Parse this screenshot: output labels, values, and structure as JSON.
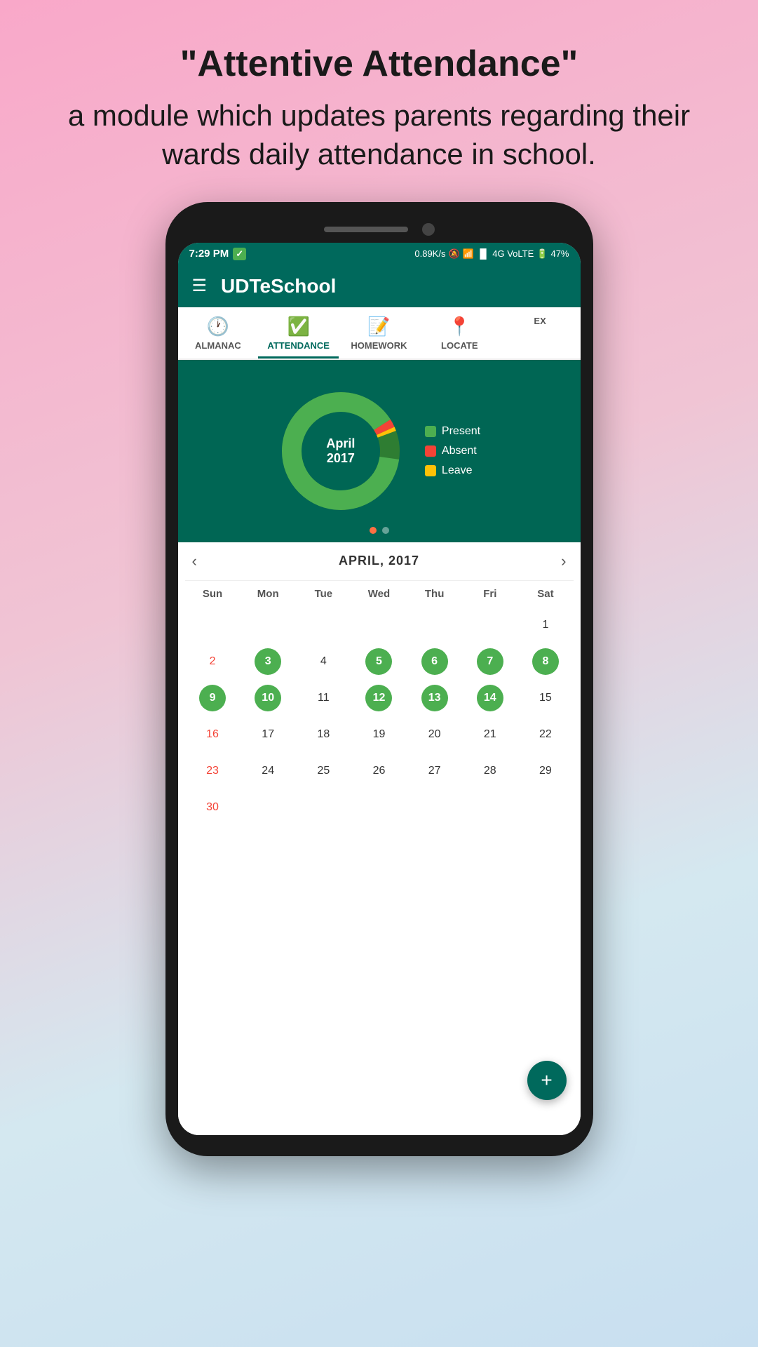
{
  "background": {
    "tagline_line1": "\"Attentive Attendance\"",
    "tagline_line2": "a module which updates parents regarding their wards daily attendance in school."
  },
  "status_bar": {
    "time": "7:29 PM",
    "network_info": "0.89K/s",
    "battery": "47%",
    "signal": "4G VoLTE"
  },
  "header": {
    "title": "UDTeSchool"
  },
  "tabs": [
    {
      "id": "almanac",
      "label": "ALMANAC",
      "active": false
    },
    {
      "id": "attendance",
      "label": "ATTENDANCE",
      "active": true
    },
    {
      "id": "homework",
      "label": "HOMEWORK",
      "active": false
    },
    {
      "id": "locate",
      "label": "LOCATE",
      "active": false
    },
    {
      "id": "ex",
      "label": "EX",
      "active": false
    }
  ],
  "chart": {
    "month": "April",
    "year": "2017",
    "legend": [
      {
        "id": "present",
        "label": "Present",
        "color": "green"
      },
      {
        "id": "absent",
        "label": "Absent",
        "color": "red"
      },
      {
        "id": "leave",
        "label": "Leave",
        "color": "orange"
      }
    ]
  },
  "calendar": {
    "title": "APRIL, 2017",
    "day_headers": [
      "Sun",
      "Mon",
      "Tue",
      "Wed",
      "Thu",
      "Fri",
      "Sat"
    ],
    "weeks": [
      [
        {
          "num": "",
          "type": "empty"
        },
        {
          "num": "",
          "type": "empty"
        },
        {
          "num": "",
          "type": "empty"
        },
        {
          "num": "",
          "type": "empty"
        },
        {
          "num": "",
          "type": "empty"
        },
        {
          "num": "",
          "type": "empty"
        },
        {
          "num": "1",
          "type": "normal"
        }
      ],
      [
        {
          "num": "2",
          "type": "sunday"
        },
        {
          "num": "3",
          "type": "present"
        },
        {
          "num": "4",
          "type": "normal"
        },
        {
          "num": "5",
          "type": "present"
        },
        {
          "num": "6",
          "type": "present"
        },
        {
          "num": "7",
          "type": "present"
        },
        {
          "num": "8",
          "type": "present"
        }
      ],
      [
        {
          "num": "9",
          "type": "present"
        },
        {
          "num": "10",
          "type": "present"
        },
        {
          "num": "11",
          "type": "normal"
        },
        {
          "num": "12",
          "type": "present"
        },
        {
          "num": "13",
          "type": "present"
        },
        {
          "num": "14",
          "type": "present"
        },
        {
          "num": "15",
          "type": "normal"
        }
      ],
      [
        {
          "num": "16",
          "type": "sunday"
        },
        {
          "num": "17",
          "type": "normal"
        },
        {
          "num": "18",
          "type": "normal"
        },
        {
          "num": "19",
          "type": "normal"
        },
        {
          "num": "20",
          "type": "normal"
        },
        {
          "num": "21",
          "type": "normal"
        },
        {
          "num": "22",
          "type": "normal"
        }
      ],
      [
        {
          "num": "23",
          "type": "sunday"
        },
        {
          "num": "24",
          "type": "normal"
        },
        {
          "num": "25",
          "type": "normal"
        },
        {
          "num": "26",
          "type": "normal"
        },
        {
          "num": "27",
          "type": "normal"
        },
        {
          "num": "28",
          "type": "normal"
        },
        {
          "num": "29",
          "type": "normal"
        }
      ],
      [
        {
          "num": "30",
          "type": "sunday"
        },
        {
          "num": "",
          "type": "empty"
        },
        {
          "num": "",
          "type": "empty"
        },
        {
          "num": "",
          "type": "empty"
        },
        {
          "num": "",
          "type": "empty"
        },
        {
          "num": "",
          "type": "empty"
        },
        {
          "num": "",
          "type": "empty"
        }
      ]
    ]
  },
  "fab": {
    "label": "+"
  }
}
